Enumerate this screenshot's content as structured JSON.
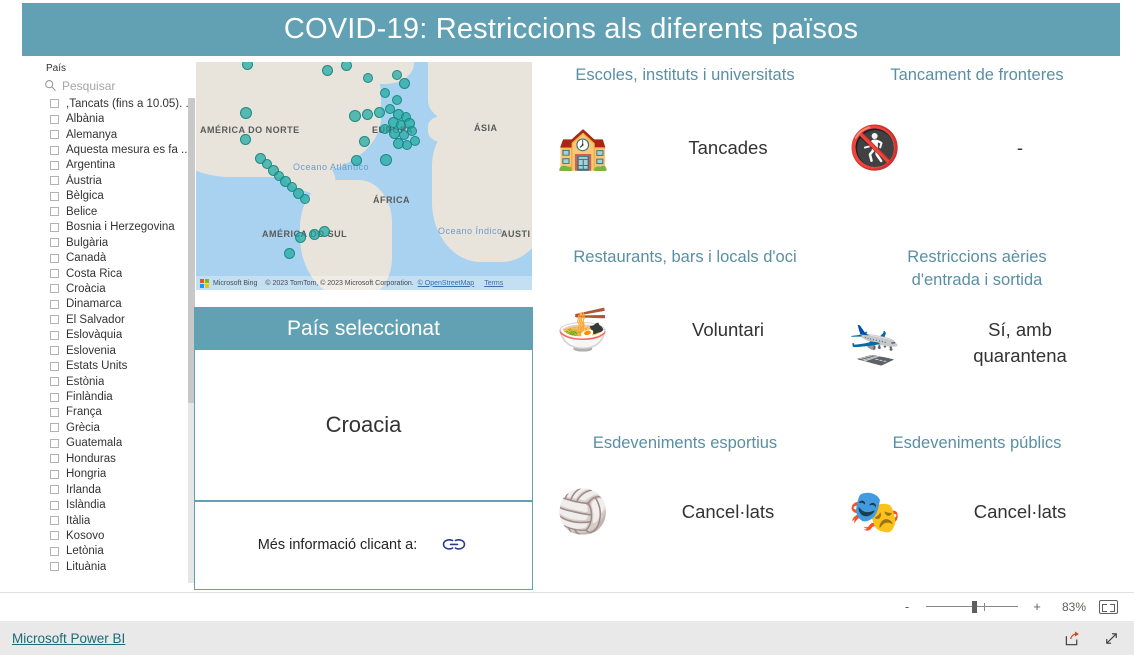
{
  "report": {
    "title": "COVID-19: Restriccions als diferents països",
    "accent_color": "#62a0b3",
    "kpi_title_color": "#5a8fa3"
  },
  "slicer": {
    "name": "País",
    "search_placeholder": "Pesquisar",
    "items": [
      ",Tancats (fins a 10.05). ...",
      "Albània",
      "Alemanya",
      "Aquesta mesura es fa ...",
      "Argentina",
      "Àustria",
      "Bèlgica",
      "Belice",
      "Bosnia i Herzegovina",
      "Bulgària",
      "Canadà",
      "Costa Rica",
      "Croàcia",
      "Dinamarca",
      "El Salvador",
      "Eslovàquia",
      "Eslovenia",
      "Estats Units",
      "Estònia",
      "Finlàndia",
      "França",
      "Grècia",
      "Guatemala",
      "Honduras",
      "Hongria",
      "Irlanda",
      "Islàndia",
      "Itàlia",
      "Kosovo",
      "Letònia",
      "Lituània"
    ]
  },
  "map": {
    "labels": [
      "AMÉRICA DO NORTE",
      "AMÉRICA DO SUL",
      "EUROPA",
      "ÁFRICA",
      "ÁSIA",
      "AUSTI"
    ],
    "ocean_labels": [
      "Oceano\nAtlântico",
      "Oceano\nÍndico"
    ],
    "bubble_color": "#1da8a1",
    "attribution": {
      "provider": "Microsoft Bing",
      "copyright": "© 2023 TomTom, © 2023 Microsoft Corporation.",
      "osm_link": "© OpenStreetMap",
      "terms_link": "Terms"
    }
  },
  "country_card": {
    "header": "País seleccionat",
    "value": "Croacia",
    "footer_text": "Més informació clicant a:"
  },
  "kpis": [
    {
      "id": "schools",
      "title": "Escoles, instituts i universitats",
      "value": "Tancades",
      "icon": "🏫",
      "icon_name": "school-icon"
    },
    {
      "id": "borders",
      "title": "Tancament de fronteres",
      "value": "-",
      "icon": "🚷",
      "icon_name": "border-officer-icon"
    },
    {
      "id": "restaurants",
      "title": "Restaurants, bars i locals d'oci",
      "value": "Voluntari",
      "icon": "🍜",
      "icon_name": "ramen-bowl-icon"
    },
    {
      "id": "air",
      "title": "Restriccions aèries\nd'entrada i sortida",
      "value": "Sí, amb\nquarantena",
      "icon": "🛬",
      "icon_name": "airplane-icon"
    },
    {
      "id": "sports",
      "title": "Esdeveniments esportius",
      "value": "Cancel·lats",
      "icon": "🏐",
      "icon_name": "volleyball-icon"
    },
    {
      "id": "public",
      "title": "Esdeveniments públics",
      "value": "Cancel·lats",
      "icon": "🎭",
      "icon_name": "theater-curtain-icon"
    }
  ],
  "zoombar": {
    "minus_label": "-",
    "plus_label": "+",
    "zoom_level": "83%"
  },
  "footer": {
    "brand": "Microsoft Power BI"
  }
}
